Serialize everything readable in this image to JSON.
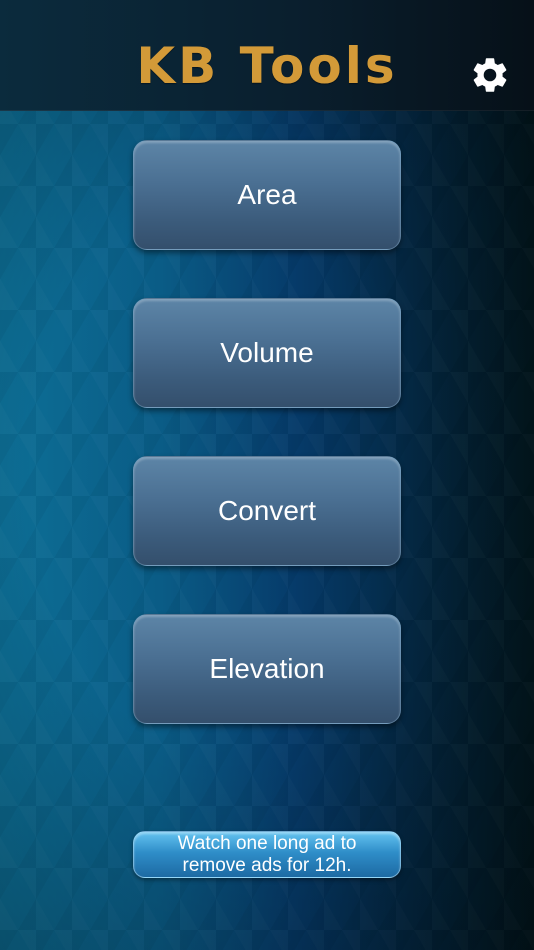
{
  "header": {
    "title": "KB Tools",
    "title_color": "#d39a38",
    "settings_icon": "gear-icon"
  },
  "menu": {
    "items": [
      {
        "label": "Area"
      },
      {
        "label": "Volume"
      },
      {
        "label": "Convert"
      },
      {
        "label": "Elevation"
      }
    ]
  },
  "ad": {
    "line1": "Watch one long ad to",
    "line2": "remove ads for 12h."
  }
}
